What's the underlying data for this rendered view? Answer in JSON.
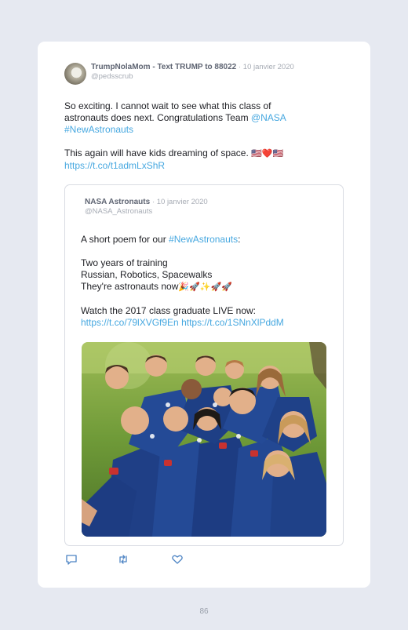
{
  "tweet": {
    "author_name": "TrumpNolaMom - Text TRUMP to 88022",
    "date": "· 10 janvier 2020",
    "handle": "@pedsscrub",
    "line1": "So exciting. I cannot wait to see what this class of",
    "line2_prefix": "astronauts does next. Congratulations Team ",
    "mention": "@NASA",
    "hashtag": "#NewAstronauts",
    "line3": "This again will have kids dreaming of space. ",
    "flags": "🇺🇸❤️🇺🇸",
    "link": "https://t.co/t1admLxShR"
  },
  "quoted": {
    "author_name": "NASA Astronauts",
    "date": "· 10 janvier 2020",
    "handle": "@NASA_Astronauts",
    "intro_prefix": "A short poem for our ",
    "intro_hashtag": "#NewAstronauts",
    "intro_suffix": ":",
    "poem_line1": "Two years of training",
    "poem_line2": "Russian, Robotics, Spacewalks",
    "poem_line3": "They're astronauts now",
    "poem_emoji": "🎉🚀✨🚀🚀",
    "watch": "Watch the 2017 class graduate LIVE now:",
    "link1": "https://t.co/79lXVGf9En",
    "link2": "https://t.co/1SNnXlPddM"
  },
  "actions": {
    "icons": [
      "reply-icon",
      "retweet-icon",
      "like-icon"
    ]
  },
  "colors": {
    "link": "#47a8e0",
    "name": "#5e6472",
    "muted": "#a6abb4",
    "background": "#e6e9f1"
  },
  "page": {
    "number": "86"
  }
}
